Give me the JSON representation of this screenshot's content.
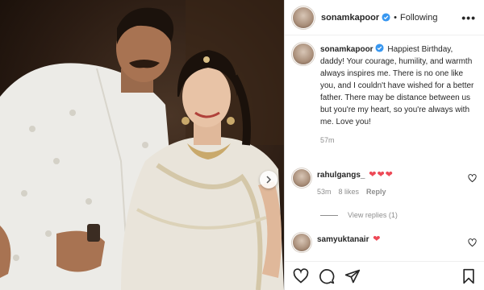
{
  "post": {
    "username": "sonamkapoor",
    "follow_label": "Following",
    "separator": "•",
    "more_label": "•••"
  },
  "caption": {
    "username": "sonamkapoor",
    "text": "Happiest Birthday, daddy! Your courage, humility, and warmth always inspires me. There is no one like you, and I couldn't have wished for a better father. There may be distance between us but you're my heart, so you're always with me. Love you!",
    "time": "57m"
  },
  "comments": [
    {
      "username": "rahulgangs_",
      "text": "❤❤❤",
      "time": "53m",
      "likes": "8 likes",
      "reply": "Reply"
    },
    {
      "username": "samyuktanair",
      "text": "❤",
      "time": "",
      "likes": "",
      "reply": ""
    }
  ],
  "view_replies": "View replies (1)",
  "icons": {
    "verified": "verified-badge-icon",
    "next": "chevron-right-icon",
    "like": "heart-icon",
    "comment": "comment-icon",
    "share": "share-icon",
    "save": "bookmark-icon"
  },
  "colors": {
    "verified": "#3897f0",
    "heart": "#ed4956",
    "muted": "#8e8e8e"
  }
}
